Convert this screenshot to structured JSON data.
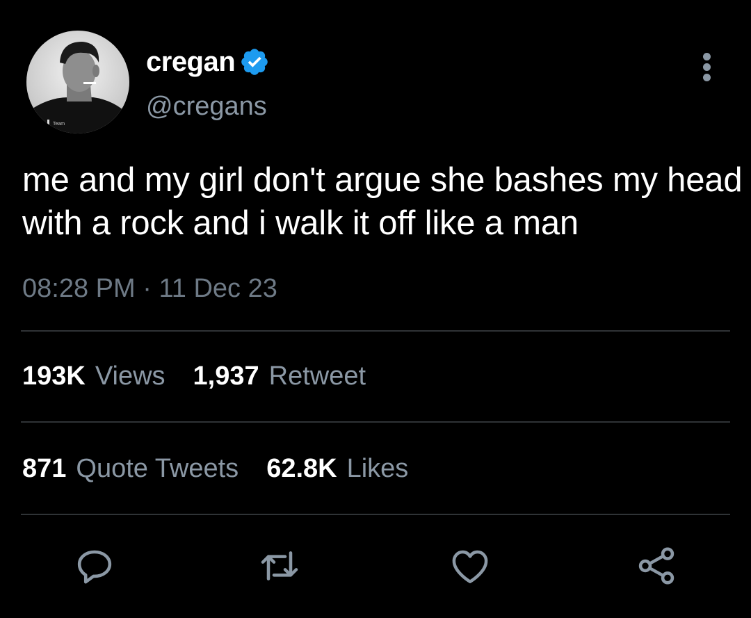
{
  "user": {
    "display_name": "cregan",
    "handle": "@cregans",
    "verified": true,
    "avatar_shirt_text": "Team"
  },
  "tweet": {
    "text": "me and my girl don't argue she bashes my head with a rock and i walk it off like a man",
    "time": "08:28 PM",
    "separator": "·",
    "date": "11 Dec 23"
  },
  "stats": {
    "views_count": "193K",
    "views_label": "Views",
    "retweets_count": "1,937",
    "retweets_label": "Retweet",
    "quotes_count": "871",
    "quotes_label": "Quote Tweets",
    "likes_count": "62.8K",
    "likes_label": "Likes"
  },
  "actions": {
    "reply_icon": "reply-bubble-icon",
    "retweet_icon": "retweet-arrows-icon",
    "like_icon": "heart-icon",
    "share_icon": "share-nodes-icon"
  },
  "colors": {
    "background": "#000000",
    "primary_text": "#ffffff",
    "secondary_text": "#8b98a5",
    "timestamp_text": "#6e7a86",
    "divider": "#2f3336",
    "verified_blue": "#1d9bf0"
  }
}
